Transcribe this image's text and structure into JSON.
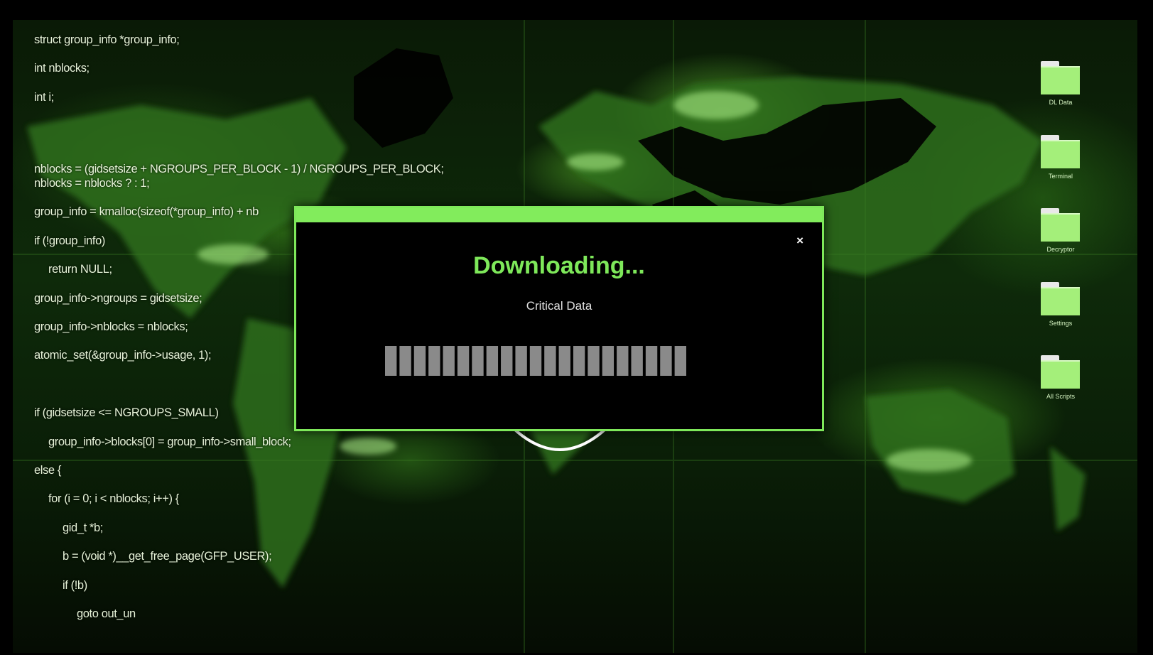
{
  "code_lines": [
    {
      "indent": 0,
      "text": "struct group_info *group_info;",
      "row": 0
    },
    {
      "indent": 0,
      "text": "int nblocks;",
      "row": 1
    },
    {
      "indent": 0,
      "text": "int i;",
      "row": 2
    },
    {
      "indent": 0,
      "text": "nblocks = (gidsetsize + NGROUPS_PER_BLOCK - 1) / NGROUPS_PER_BLOCK;",
      "row": 4.5
    },
    {
      "indent": 0,
      "text": "nblocks = nblocks ? : 1;",
      "row": 5
    },
    {
      "indent": 0,
      "text": "group_info = kmalloc(sizeof(*group_info) + nb",
      "row": 6
    },
    {
      "indent": 0,
      "text": "if (!group_info)",
      "row": 7
    },
    {
      "indent": 1,
      "text": "return NULL;",
      "row": 8
    },
    {
      "indent": 0,
      "text": "group_info->ngroups = gidsetsize;",
      "row": 9
    },
    {
      "indent": 0,
      "text": "group_info->nblocks = nblocks;",
      "row": 10
    },
    {
      "indent": 0,
      "text": "atomic_set(&group_info->usage, 1);",
      "row": 11
    },
    {
      "indent": 0,
      "text": "if (gidsetsize <= NGROUPS_SMALL)",
      "row": 13
    },
    {
      "indent": 1,
      "text": "group_info->blocks[0] = group_info->small_block;",
      "row": 14
    },
    {
      "indent": 0,
      "text": "else {",
      "row": 15
    },
    {
      "indent": 1,
      "text": "for (i = 0; i < nblocks; i++) {",
      "row": 16
    },
    {
      "indent": 2,
      "text": "gid_t *b;",
      "row": 17
    },
    {
      "indent": 2,
      "text": "b = (void *)__get_free_page(GFP_USER);",
      "row": 18
    },
    {
      "indent": 2,
      "text": "if (!b)",
      "row": 19
    },
    {
      "indent": 3,
      "text": "goto out_un",
      "row": 20
    }
  ],
  "desktop_icons": [
    {
      "label": "DL Data",
      "icon": "folder-icon"
    },
    {
      "label": "Terminal",
      "icon": "folder-icon"
    },
    {
      "label": "Decryptor",
      "icon": "folder-icon"
    },
    {
      "label": "Settings",
      "icon": "folder-icon"
    },
    {
      "label": "All Scripts",
      "icon": "folder-icon"
    }
  ],
  "dialog": {
    "close_label": "×",
    "title": "Downloading...",
    "subtitle": "Critical Data",
    "progress_segments_total": 21,
    "progress_segments_filled": 21,
    "progress_color": "#8a8a8a"
  },
  "colors": {
    "accent": "#7ee85a",
    "folder": "#a4ef7a",
    "background": "#000000"
  }
}
